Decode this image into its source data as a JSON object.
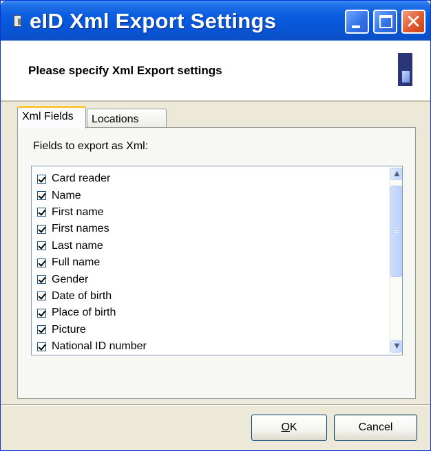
{
  "window": {
    "title": "eID Xml Export Settings"
  },
  "header": {
    "text": "Please specify Xml Export settings",
    "icon": "card-reader-icon"
  },
  "tabs": [
    {
      "label": "Xml Fields",
      "selected": true
    },
    {
      "label": "Locations",
      "selected": false
    }
  ],
  "xml_fields": {
    "label": "Fields to export as Xml:",
    "items": [
      {
        "label": "Card reader",
        "checked": true
      },
      {
        "label": "Name",
        "checked": true
      },
      {
        "label": "First name",
        "checked": true
      },
      {
        "label": "First names",
        "checked": true
      },
      {
        "label": "Last name",
        "checked": true
      },
      {
        "label": "Full name",
        "checked": true
      },
      {
        "label": "Gender",
        "checked": true
      },
      {
        "label": "Date of birth",
        "checked": true
      },
      {
        "label": "Place of birth",
        "checked": true
      },
      {
        "label": "Picture",
        "checked": true
      },
      {
        "label": "National ID number",
        "checked": true
      }
    ]
  },
  "buttons": {
    "ok_mnemonic": "O",
    "ok_rest": "K",
    "cancel": "Cancel"
  },
  "colors": {
    "titlebar": "#0a5ce0",
    "window_bg": "#ece9d8",
    "active_tab_accent": "#ffc83c"
  }
}
